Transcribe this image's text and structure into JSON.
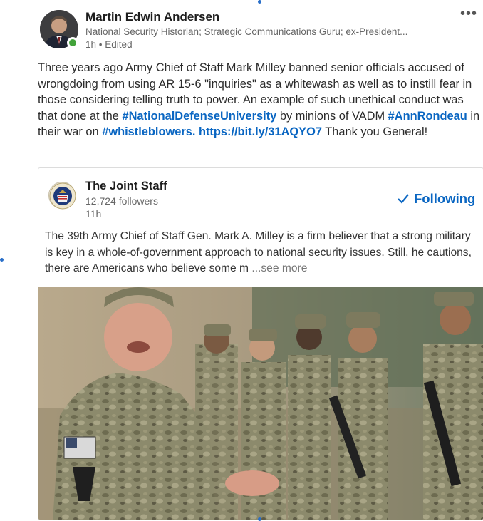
{
  "author": {
    "name": "Martin Edwin Andersen",
    "headline": "National Security Historian; Strategic Communications Guru; ex-President...",
    "time": "1h",
    "separator": "•",
    "edited": "Edited"
  },
  "menu": {
    "more": "•••"
  },
  "post": {
    "text_1": "Three years ago Army Chief of Staff Mark Milley banned senior officials accused of wrongdoing from using AR 15-6 \"inquiries\" as a whitewash as well as to instill fear in those considering telling truth to power. An example of such unethical conduct was that done at the ",
    "hashtag_1": "#NationalDefenseUniversity",
    "text_2": " by minions of VADM ",
    "hashtag_2": "#AnnRondeau",
    "text_3": " in their war on ",
    "hashtag_3": "#whistleblowers.",
    "text_4": " ",
    "link": "https://bit.ly/31AQYO7",
    "text_5": " Thank you General!"
  },
  "shared": {
    "org_name": "The Joint Staff",
    "followers": "12,724 followers",
    "time": "11h",
    "follow_label": "Following",
    "text": "The 39th Army Chief of Staff Gen. Mark A. Milley is a firm believer that a strong military is key in a whole-of-government approach to national security issues. Still, he cautions, there are Americans who believe some m",
    "see_more": "...see more"
  },
  "colors": {
    "link": "#0a66c2",
    "online": "#42a33a",
    "camo": "#7d7a5e"
  }
}
